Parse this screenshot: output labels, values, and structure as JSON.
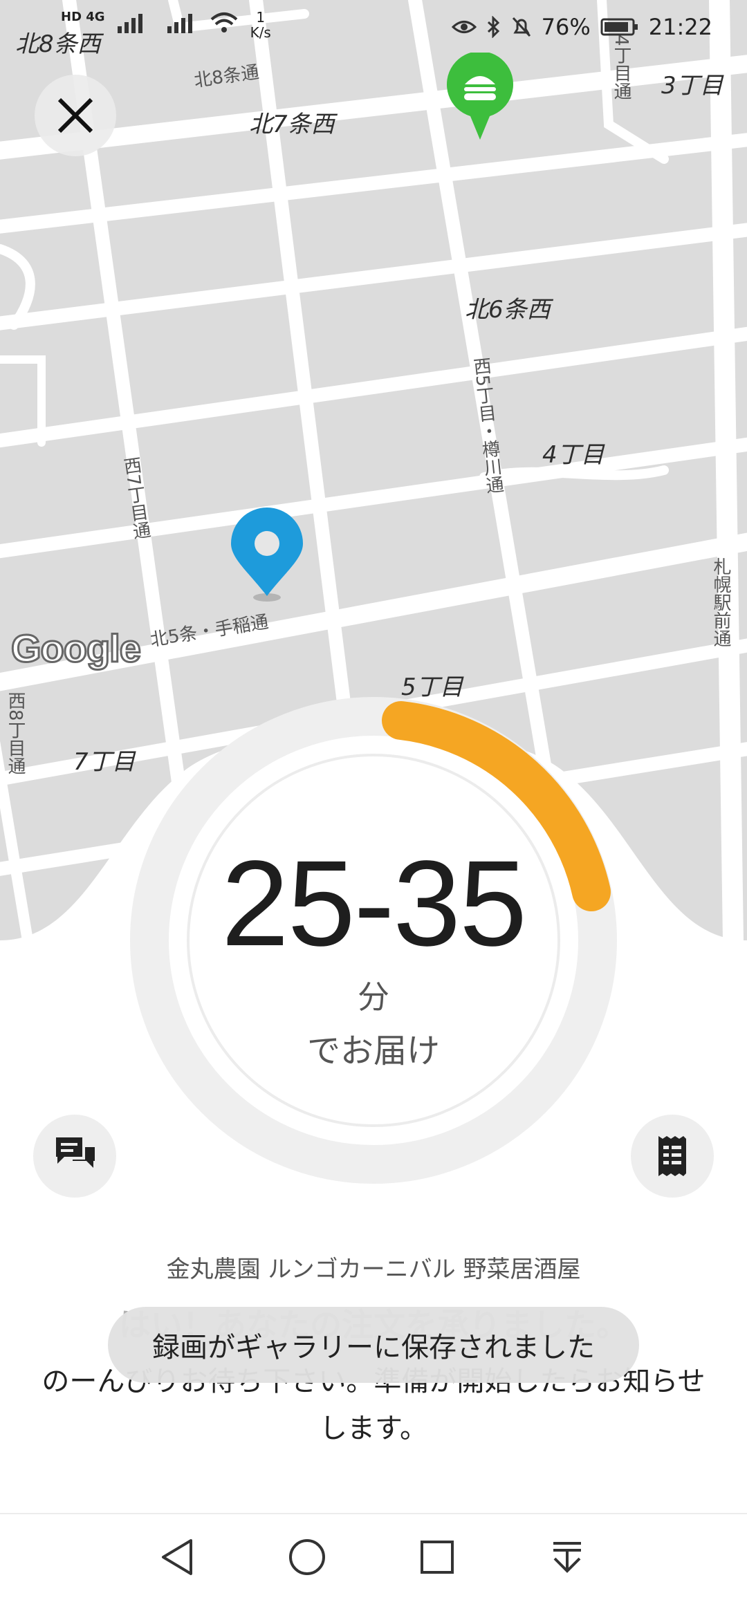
{
  "status_bar": {
    "network_badges": "HD 4G",
    "speed_value": "1",
    "speed_unit": "K/s",
    "battery": "76%",
    "time": "21:22"
  },
  "map": {
    "area_labels": [
      "北8条西",
      "北7条西",
      "北6条西",
      "3丁目",
      "4丁目",
      "5丁目",
      "7丁目"
    ],
    "street_labels": [
      "北8条通",
      "北5条・手稲通"
    ],
    "vertical_street_labels": [
      "4丁目通",
      "西5丁目・樽川通",
      "西7丁目通",
      "札幌駅前通",
      "西8丁目通"
    ],
    "attribution": "Google",
    "restaurant_pin_icon": "burger-icon",
    "destination_pin_icon": "location-pin-icon"
  },
  "eta": {
    "range": "25-35",
    "unit": "分",
    "caption": "でお届け",
    "progress_color": "#F5A623"
  },
  "actions": {
    "chat_icon": "chat-icon",
    "receipt_icon": "receipt-icon"
  },
  "order": {
    "restaurant_name": "金丸農園 ルンゴカーニバル 野菜居酒屋",
    "headline": "はい！あなたの注文を承りました。",
    "body": "のーんびりお待ち下さい。準備が開始したらお知らせします。"
  },
  "toast": {
    "message": "録画がギャラリーに保存されました"
  },
  "nav_bar": {
    "buttons": [
      "back",
      "home",
      "recents",
      "notifications"
    ]
  },
  "colors": {
    "accent": "#F5A623",
    "restaurant_pin": "#3DBE3D",
    "destination_pin": "#1E9BDB",
    "map_background": "#DCDCDC"
  }
}
